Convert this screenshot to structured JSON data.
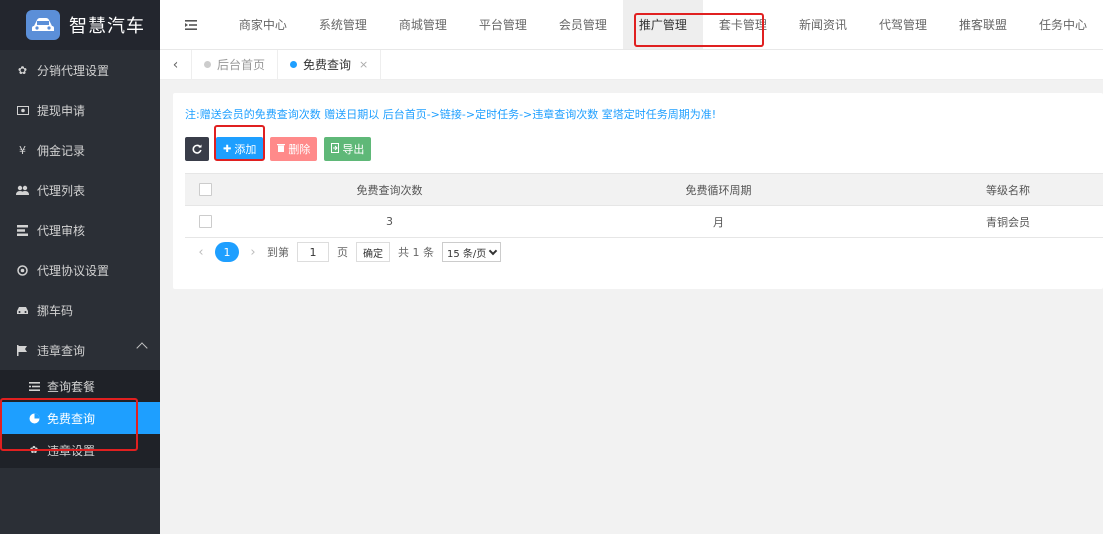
{
  "app": {
    "title": "智慧汽车"
  },
  "sidebar": {
    "items": [
      {
        "label": "分销代理设置",
        "icon": "gear-icon"
      },
      {
        "label": "提现申请",
        "icon": "money-icon"
      },
      {
        "label": "佣金记录",
        "icon": "yen-icon"
      },
      {
        "label": "代理列表",
        "icon": "users-icon"
      },
      {
        "label": "代理审核",
        "icon": "audit-icon"
      },
      {
        "label": "代理协议设置",
        "icon": "settings-icon"
      },
      {
        "label": "挪车码",
        "icon": "car-icon"
      },
      {
        "label": "违章查询",
        "icon": "flag-icon"
      }
    ],
    "submenu": [
      {
        "label": "查询套餐",
        "icon": "list-icon"
      },
      {
        "label": "免费查询",
        "icon": "pie-icon"
      },
      {
        "label": "违章设置",
        "icon": "gear-icon"
      }
    ]
  },
  "topnav": {
    "items": [
      "商家中心",
      "系统管理",
      "商城管理",
      "平台管理",
      "会员管理",
      "推广管理",
      "套卡管理",
      "新闻资讯",
      "代驾管理",
      "推客联盟",
      "任务中心"
    ]
  },
  "tabs": [
    {
      "label": "后台首页"
    },
    {
      "label": "免费查询",
      "close": "×"
    }
  ],
  "content": {
    "note": "注:赠送会员的免费查询次数 赠送日期以 后台首页->链接->定时任务->违章查询次数 室塔定时任务周期为准!",
    "toolbar": {
      "add_label": "添加",
      "delete_label": "删除",
      "export_label": "导出"
    },
    "table": {
      "headers": [
        "免费查询次数",
        "免费循环周期",
        "等级名称"
      ],
      "rows": [
        [
          "3",
          "月",
          "青铜会员"
        ]
      ]
    },
    "pager": {
      "current": "1",
      "goto_label": "到第",
      "page_input": "1",
      "page_unit": "页",
      "confirm_label": "确定",
      "total_label": "共 1 条",
      "page_size": "15 条/页"
    }
  },
  "colors": {
    "accent": "#1e9fff",
    "sidebar_bg": "#2b2f36",
    "highlight": "#e02020"
  }
}
